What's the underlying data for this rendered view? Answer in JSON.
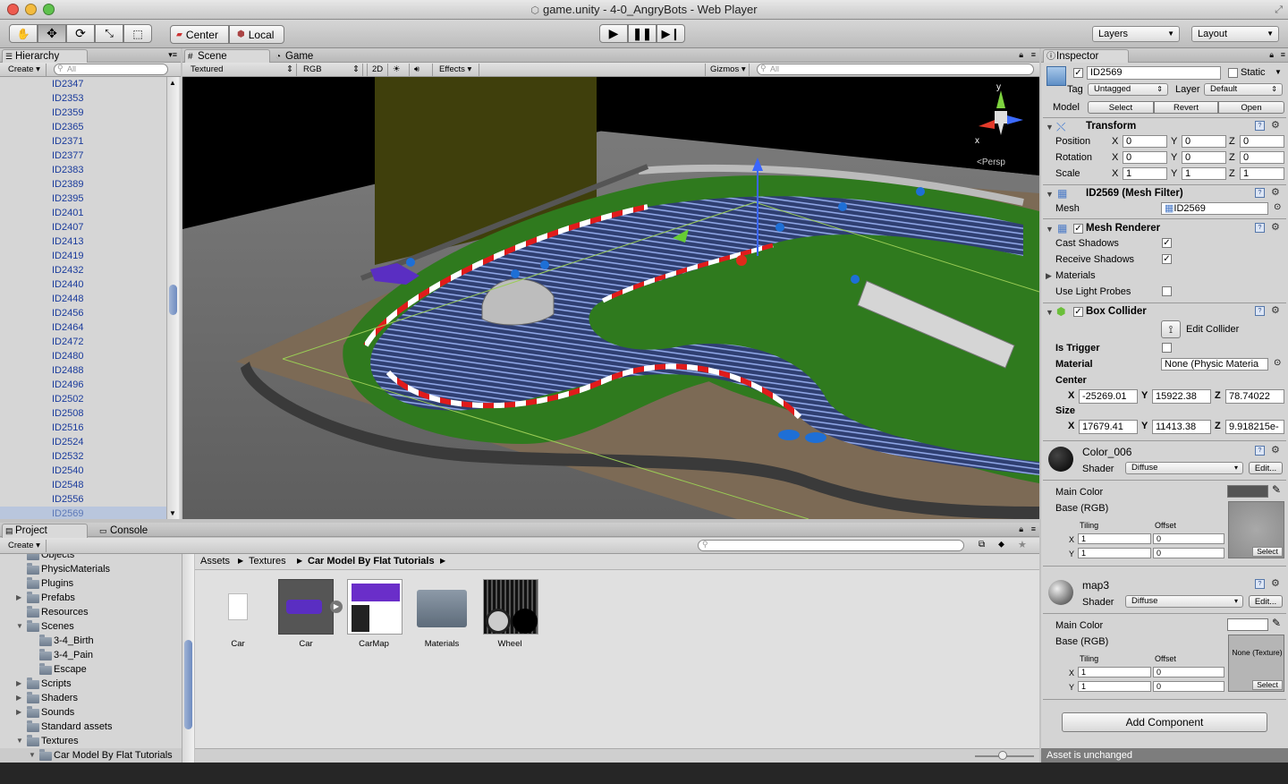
{
  "window": {
    "title": "game.unity - 4-0_AngryBots - Web Player"
  },
  "toolbar": {
    "pivot_center": "Center",
    "pivot_local": "Local",
    "layers": "Layers",
    "layout": "Layout"
  },
  "hierarchy": {
    "tab": "Hierarchy",
    "create": "Create",
    "search_placeholder": "All",
    "items": [
      "ID2347",
      "ID2353",
      "ID2359",
      "ID2365",
      "ID2371",
      "ID2377",
      "ID2383",
      "ID2389",
      "ID2395",
      "ID2401",
      "ID2407",
      "ID2413",
      "ID2419",
      "ID2432",
      "ID2440",
      "ID2448",
      "ID2456",
      "ID2464",
      "ID2472",
      "ID2480",
      "ID2488",
      "ID2496",
      "ID2502",
      "ID2508",
      "ID2516",
      "ID2524",
      "ID2532",
      "ID2540",
      "ID2548",
      "ID2556",
      "ID2569"
    ],
    "selected": "ID2569"
  },
  "scene": {
    "tab_scene": "Scene",
    "tab_game": "Game",
    "render_mode": "Textured",
    "color_mode": "RGB",
    "btn_2d": "2D",
    "effects": "Effects",
    "gizmos": "Gizmos",
    "search_placeholder": "All",
    "persp_label": "Persp",
    "axis_y": "y",
    "axis_x": "x"
  },
  "inspector": {
    "tab": "Inspector",
    "object_name": "ID2569",
    "static_label": "Static",
    "tag_label": "Tag",
    "tag_value": "Untagged",
    "layer_label": "Layer",
    "layer_value": "Default",
    "model_label": "Model",
    "model_select": "Select",
    "model_revert": "Revert",
    "model_open": "Open",
    "transform": {
      "title": "Transform",
      "position_label": "Position",
      "rotation_label": "Rotation",
      "scale_label": "Scale",
      "position": [
        "0",
        "0",
        "0"
      ],
      "rotation": [
        "0",
        "0",
        "0"
      ],
      "scale": [
        "1",
        "1",
        "1"
      ]
    },
    "mesh_filter": {
      "title": "ID2569 (Mesh Filter)",
      "mesh_label": "Mesh",
      "mesh_value": "ID2569"
    },
    "mesh_renderer": {
      "title": "Mesh Renderer",
      "cast_shadows": "Cast Shadows",
      "receive_shadows": "Receive Shadows",
      "materials": "Materials",
      "use_light_probes": "Use Light Probes"
    },
    "box_collider": {
      "title": "Box Collider",
      "edit_collider": "Edit Collider",
      "is_trigger": "Is Trigger",
      "material_label": "Material",
      "material_value": "None (Physic Materia",
      "center_label": "Center",
      "size_label": "Size",
      "center": [
        "-25269.01",
        "15922.38",
        "78.74022"
      ],
      "size": [
        "17679.41",
        "11413.38",
        "9.918215e-"
      ]
    },
    "axis": [
      "X",
      "Y",
      "Z"
    ],
    "materials": [
      {
        "name": "Color_006",
        "shader_label": "Shader",
        "shader": "Diffuse",
        "edit": "Edit...",
        "main_color": "Main Color",
        "base": "Base (RGB)",
        "tiling": "Tiling",
        "offset": "Offset",
        "tiling_x": "1",
        "tiling_y": "1",
        "offset_x": "0",
        "offset_y": "0",
        "select": "Select",
        "texture_note": "",
        "swatch": "#555555"
      },
      {
        "name": "map3",
        "shader_label": "Shader",
        "shader": "Diffuse",
        "edit": "Edit...",
        "main_color": "Main Color",
        "base": "Base (RGB)",
        "tiling": "Tiling",
        "offset": "Offset",
        "tiling_x": "1",
        "tiling_y": "1",
        "offset_x": "0",
        "offset_y": "0",
        "select": "Select",
        "texture_note": "None (Texture)",
        "swatch": "#ffffff"
      }
    ],
    "add_component": "Add Component",
    "status": "Asset is unchanged"
  },
  "project": {
    "tab_project": "Project",
    "tab_console": "Console",
    "create": "Create",
    "tree": [
      {
        "label": "Objects",
        "indent": 0,
        "arrow": ""
      },
      {
        "label": "PhysicMaterials",
        "indent": 0,
        "arrow": ""
      },
      {
        "label": "Plugins",
        "indent": 0,
        "arrow": ""
      },
      {
        "label": "Prefabs",
        "indent": 0,
        "arrow": "▶"
      },
      {
        "label": "Resources",
        "indent": 0,
        "arrow": ""
      },
      {
        "label": "Scenes",
        "indent": 0,
        "arrow": "▼"
      },
      {
        "label": "3-4_Birth",
        "indent": 1,
        "arrow": ""
      },
      {
        "label": "3-4_Pain",
        "indent": 1,
        "arrow": ""
      },
      {
        "label": "Escape",
        "indent": 1,
        "arrow": ""
      },
      {
        "label": "Scripts",
        "indent": 0,
        "arrow": "▶"
      },
      {
        "label": "Shaders",
        "indent": 0,
        "arrow": "▶"
      },
      {
        "label": "Sounds",
        "indent": 0,
        "arrow": "▶"
      },
      {
        "label": "Standard assets",
        "indent": 0,
        "arrow": ""
      },
      {
        "label": "Textures",
        "indent": 0,
        "arrow": "▼"
      },
      {
        "label": "Car Model By Flat Tutorials",
        "indent": 1,
        "arrow": "▼"
      }
    ],
    "breadcrumb": [
      "Assets",
      "Textures",
      "Car Model By Flat Tutorials"
    ],
    "assets": [
      "Car",
      "Car",
      "CarMap",
      "Materials",
      "Wheel"
    ]
  }
}
